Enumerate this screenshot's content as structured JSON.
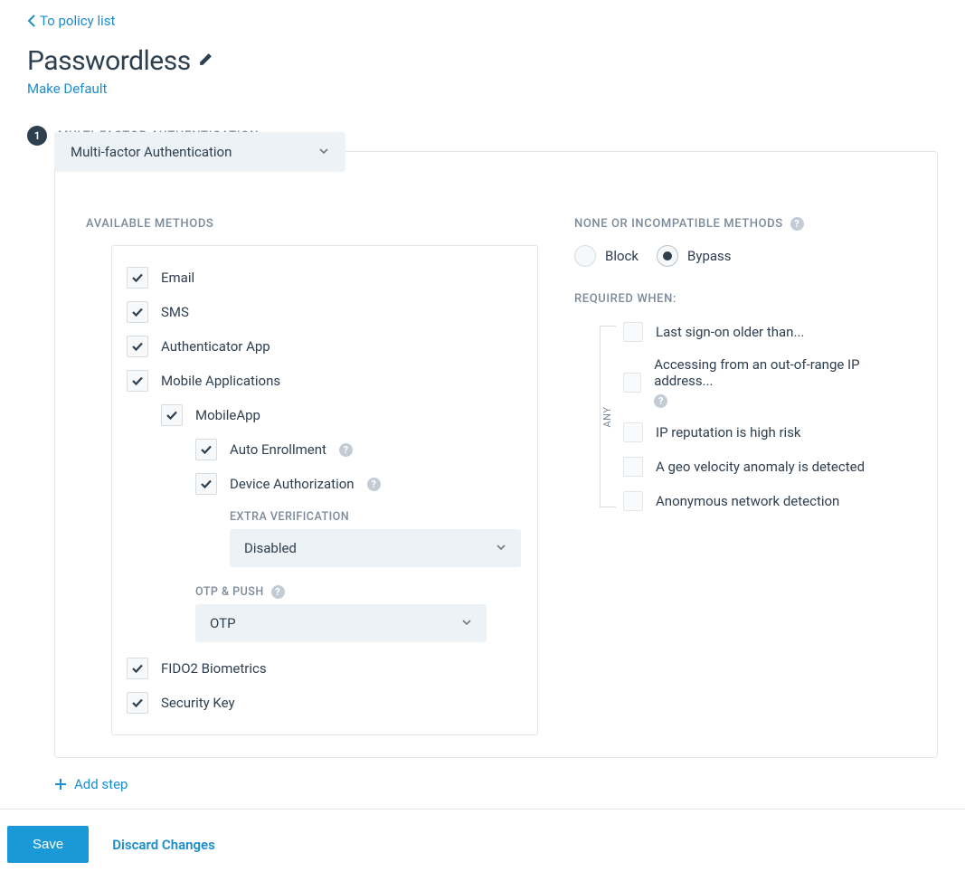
{
  "back_link": "To policy list",
  "title": "Passwordless",
  "make_default": "Make Default",
  "step": {
    "number": "1",
    "label": "MULTI-FACTOR AUTHENTICATION",
    "dropdown": "Multi-factor Authentication"
  },
  "available_methods_label": "AVAILABLE METHODS",
  "methods": {
    "email": "Email",
    "sms": "SMS",
    "authenticator": "Authenticator App",
    "mobile_apps": "Mobile Applications",
    "mobileapp": "MobileApp",
    "auto_enroll": "Auto Enrollment",
    "device_auth": "Device Authorization",
    "extra_verif_label": "EXTRA VERIFICATION",
    "extra_verif_value": "Disabled",
    "otp_push_label": "OTP & PUSH",
    "otp_push_value": "OTP",
    "fido2": "FIDO2 Biometrics",
    "security_key": "Security Key"
  },
  "none_incompat": {
    "label": "NONE OR INCOMPATIBLE METHODS",
    "block": "Block",
    "bypass": "Bypass"
  },
  "required_when": {
    "label": "REQUIRED WHEN:",
    "any": "ANY",
    "c1": "Last sign-on older than...",
    "c2": "Accessing from an out-of-range IP address...",
    "c3": "IP reputation is high risk",
    "c4": "A geo velocity anomaly is detected",
    "c5": "Anonymous network detection"
  },
  "add_step": "Add step",
  "footer": {
    "save": "Save",
    "discard": "Discard Changes"
  }
}
